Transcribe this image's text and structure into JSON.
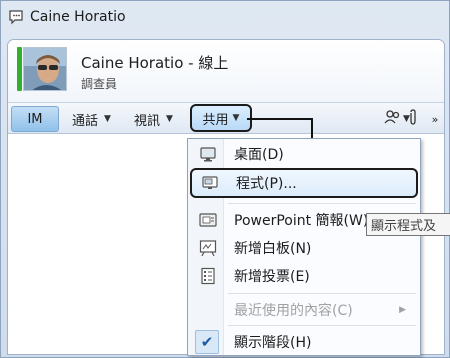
{
  "window": {
    "title": "Caine Horatio",
    "icon": "chat-bubble-icon"
  },
  "contact": {
    "name_line": "Caine Horatio - 線上",
    "title": "調查員",
    "presence_color": "#2fb12b"
  },
  "toolbar": {
    "im_label": "IM",
    "call_label": "通話",
    "video_label": "視訊",
    "share_label": "共用",
    "more_label": "»"
  },
  "share_menu": {
    "items": [
      {
        "label": "桌面(D)",
        "icon": "desktop-icon"
      },
      {
        "label": "程式(P)...",
        "icon": "program-window-icon",
        "highlighted": true
      },
      {
        "label": "PowerPoint 簡報(W)",
        "icon": "presentation-icon"
      },
      {
        "label": "新增白板(N)",
        "icon": "whiteboard-icon"
      },
      {
        "label": "新增投票(E)",
        "icon": "poll-icon"
      },
      {
        "label": "最近使用的內容(C)",
        "disabled": true,
        "has_submenu": true
      },
      {
        "label": "顯示階段(H)",
        "checked": true
      }
    ]
  },
  "tooltip": {
    "text": "顯示程式及"
  },
  "colors": {
    "accent": "#7fb5e6",
    "callout": "#111111"
  }
}
